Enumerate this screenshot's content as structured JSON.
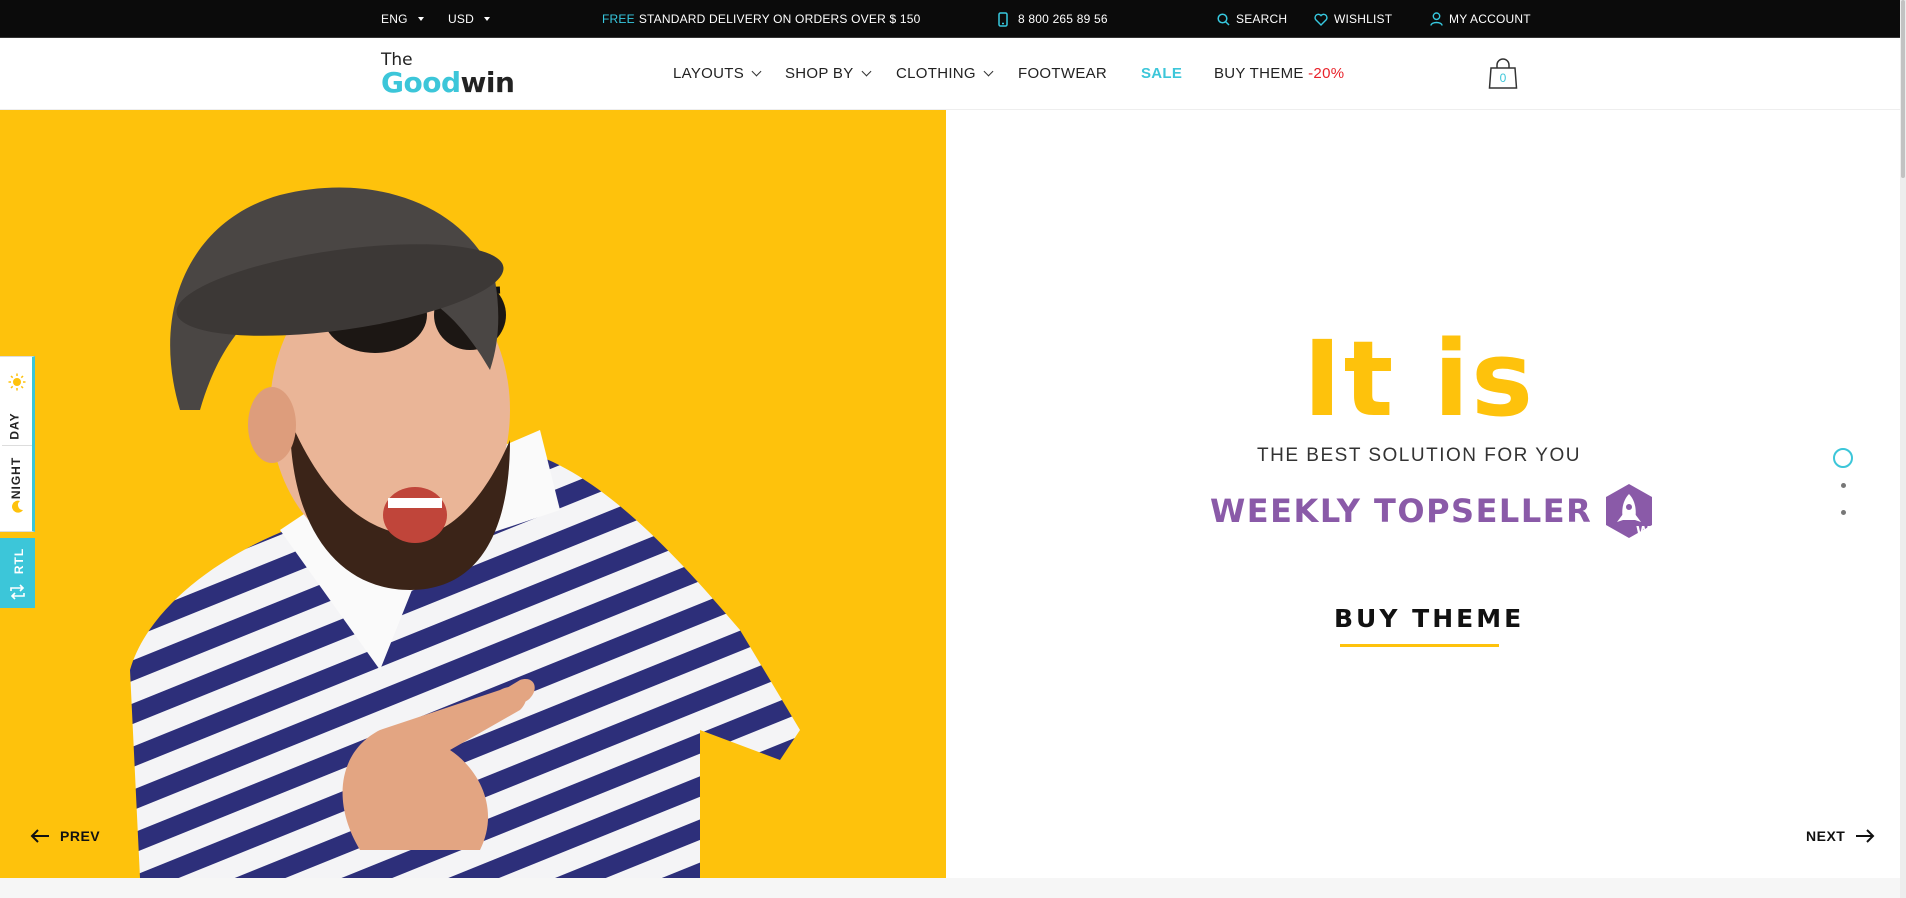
{
  "topbar": {
    "language": "ENG",
    "currency": "USD",
    "promo_free": "FREE",
    "promo_text": "STANDARD DELIVERY ON ORDERS OVER $ 150",
    "phone": "8 800 265 89 56",
    "search_label": "SEARCH",
    "wishlist_label": "WISHLIST",
    "account_label": "MY ACCOUNT"
  },
  "logo": {
    "the": "The",
    "good": "Good",
    "win": "win"
  },
  "nav": {
    "layouts": "LAYOUTS",
    "shop_by": "SHOP BY",
    "clothing": "CLOTHING",
    "footwear": "FOOTWEAR",
    "sale": "SALE",
    "buy_theme": "BUY THEME",
    "discount": "-20%"
  },
  "cart": {
    "count": "0"
  },
  "hero": {
    "headline": "It is",
    "subtitle": "THE BEST SOLUTION FOR YOU",
    "topseller": "WEEKLY TOPSELLER",
    "cta": "BUY THEME",
    "prev": "PREV",
    "next": "NEXT",
    "slide_count": 3,
    "active_slide": 1
  },
  "switcher": {
    "day": "DAY",
    "night": "NIGHT",
    "rtl": "RTL"
  },
  "colors": {
    "accent": "#3cc6d9",
    "yellow": "#fec20c",
    "purple": "#8a5aa8",
    "sale_red": "#e8222a",
    "topbar_bg": "#0b0b0b"
  }
}
